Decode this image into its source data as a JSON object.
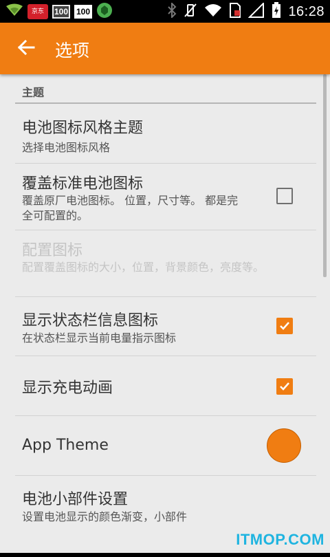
{
  "status_bar": {
    "notifications": [
      "wifi-notify-icon",
      "jd-app-icon",
      "badge-100",
      "badge-100",
      "shield-app-icon"
    ],
    "jd_label": "京东",
    "badge_a": "100",
    "badge_b": "100",
    "time": "16:28"
  },
  "app_bar": {
    "title": "选项",
    "back_icon": "arrow-back-icon"
  },
  "section": {
    "title": "主题"
  },
  "prefs": [
    {
      "title": "电池图标风格主题",
      "summary": "选择电池图标风格",
      "widget": "none"
    },
    {
      "title": "覆盖标准电池图标",
      "summary": "覆盖原厂电池图标。 位置，尺寸等。 都是完全可配置的。",
      "widget": "checkbox",
      "checked": false
    },
    {
      "title": "配置图标",
      "summary": "配置覆盖图标的大小，位置，背景颜色，亮度等。",
      "widget": "none",
      "enabled": false
    },
    {
      "title": "显示状态栏信息图标",
      "summary": "在状态栏显示当前电量指示图标",
      "widget": "checkbox",
      "checked": true
    },
    {
      "title": "显示充电动画",
      "summary": "",
      "widget": "checkbox",
      "checked": true
    },
    {
      "title": "App Theme",
      "summary": "",
      "widget": "color-swatch"
    },
    {
      "title": "电池小部件设置",
      "summary": "设置电池显示的颜色渐变，小部件",
      "widget": "none"
    }
  ],
  "watermark": "ITMOP.COM",
  "colors": {
    "accent": "#f07d12",
    "background": "#ebebeb",
    "status_bar": "#000000"
  }
}
